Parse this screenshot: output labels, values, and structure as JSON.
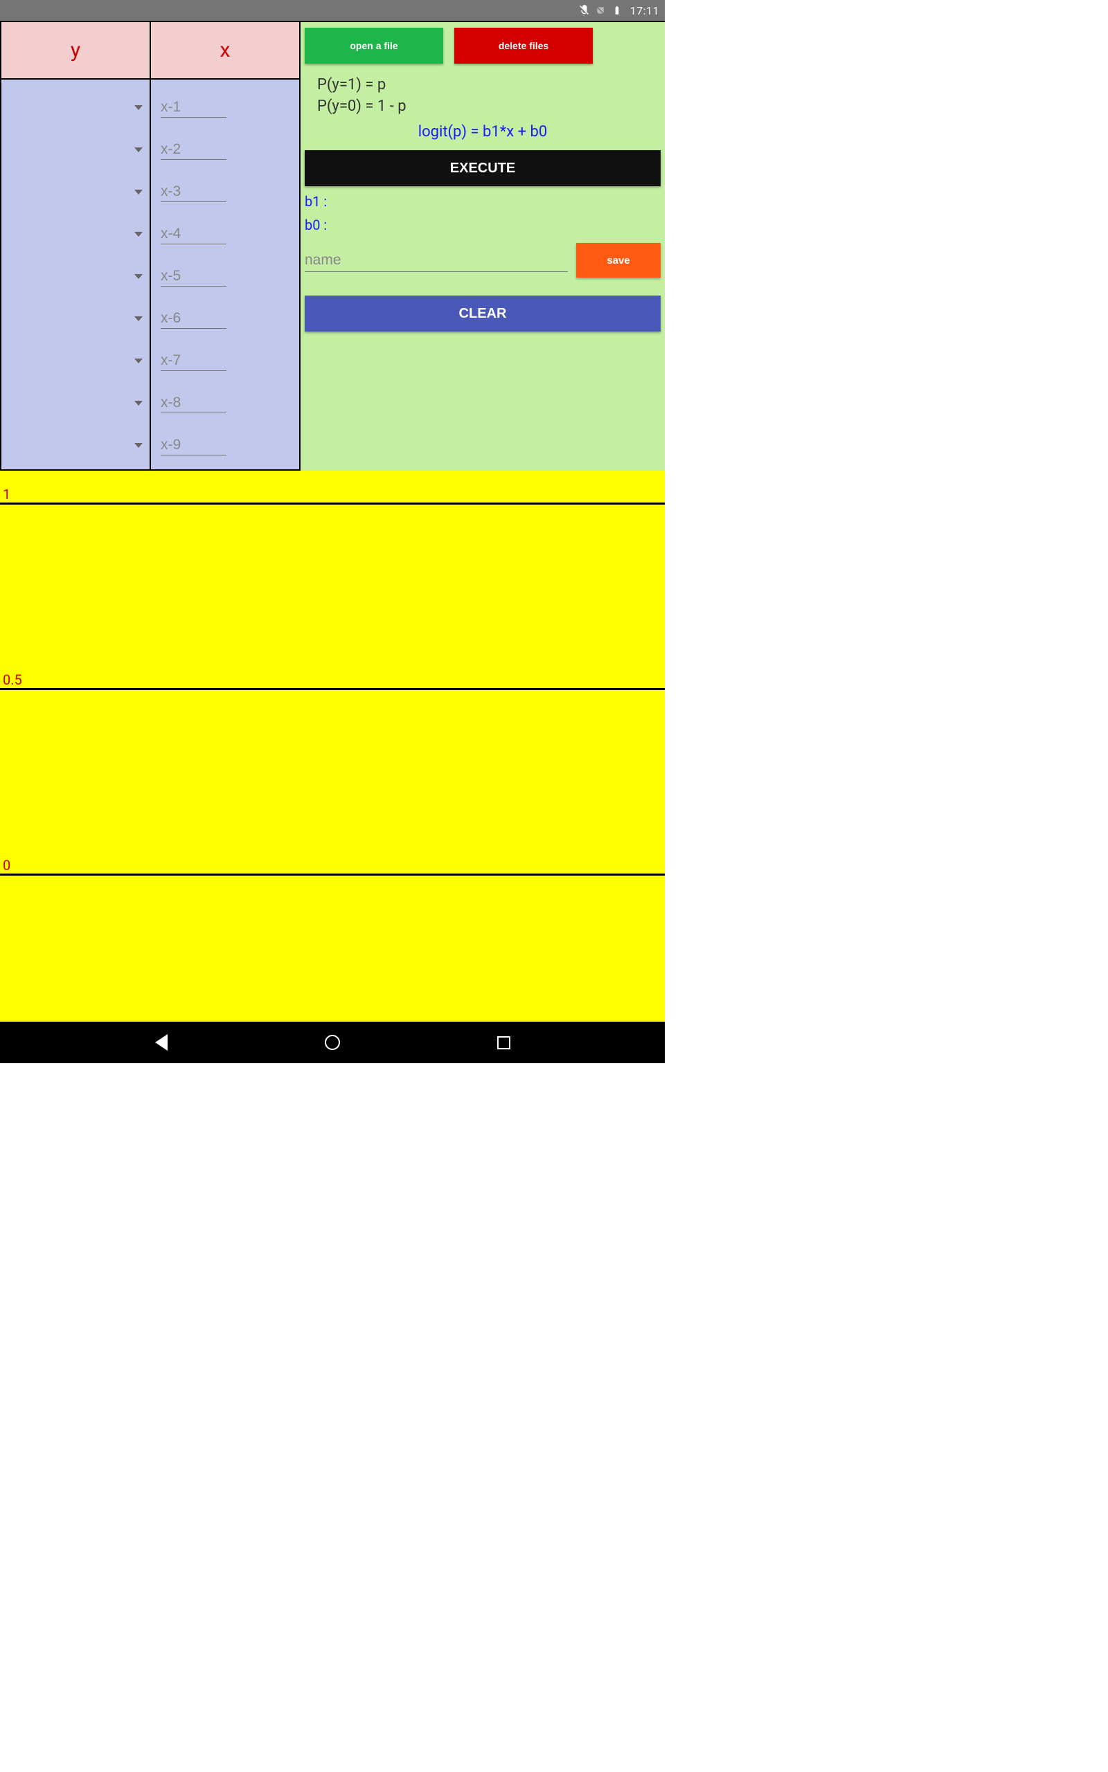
{
  "status": {
    "time": "17:11"
  },
  "table": {
    "headers": {
      "y": "y",
      "x": "x"
    },
    "x_placeholders": [
      "x-1",
      "x-2",
      "x-3",
      "x-4",
      "x-5",
      "x-6",
      "x-7",
      "x-8",
      "x-9"
    ]
  },
  "controls": {
    "open_label": "open a file",
    "delete_label": "delete files",
    "formula1": "P(y=1) = p",
    "formula2": "P(y=0) = 1 - p",
    "logit": "logit(p) = b1*x + b0",
    "execute_label": "EXECUTE",
    "b1_label": "b1 :",
    "b0_label": "b0 :",
    "name_placeholder": "name",
    "save_label": "save",
    "clear_label": "CLEAR"
  },
  "chart_data": {
    "type": "line",
    "title": "",
    "xlabel": "",
    "ylabel": "",
    "ylim": [
      0,
      1
    ],
    "y_ticks": [
      1,
      0.5,
      0
    ],
    "series": []
  }
}
